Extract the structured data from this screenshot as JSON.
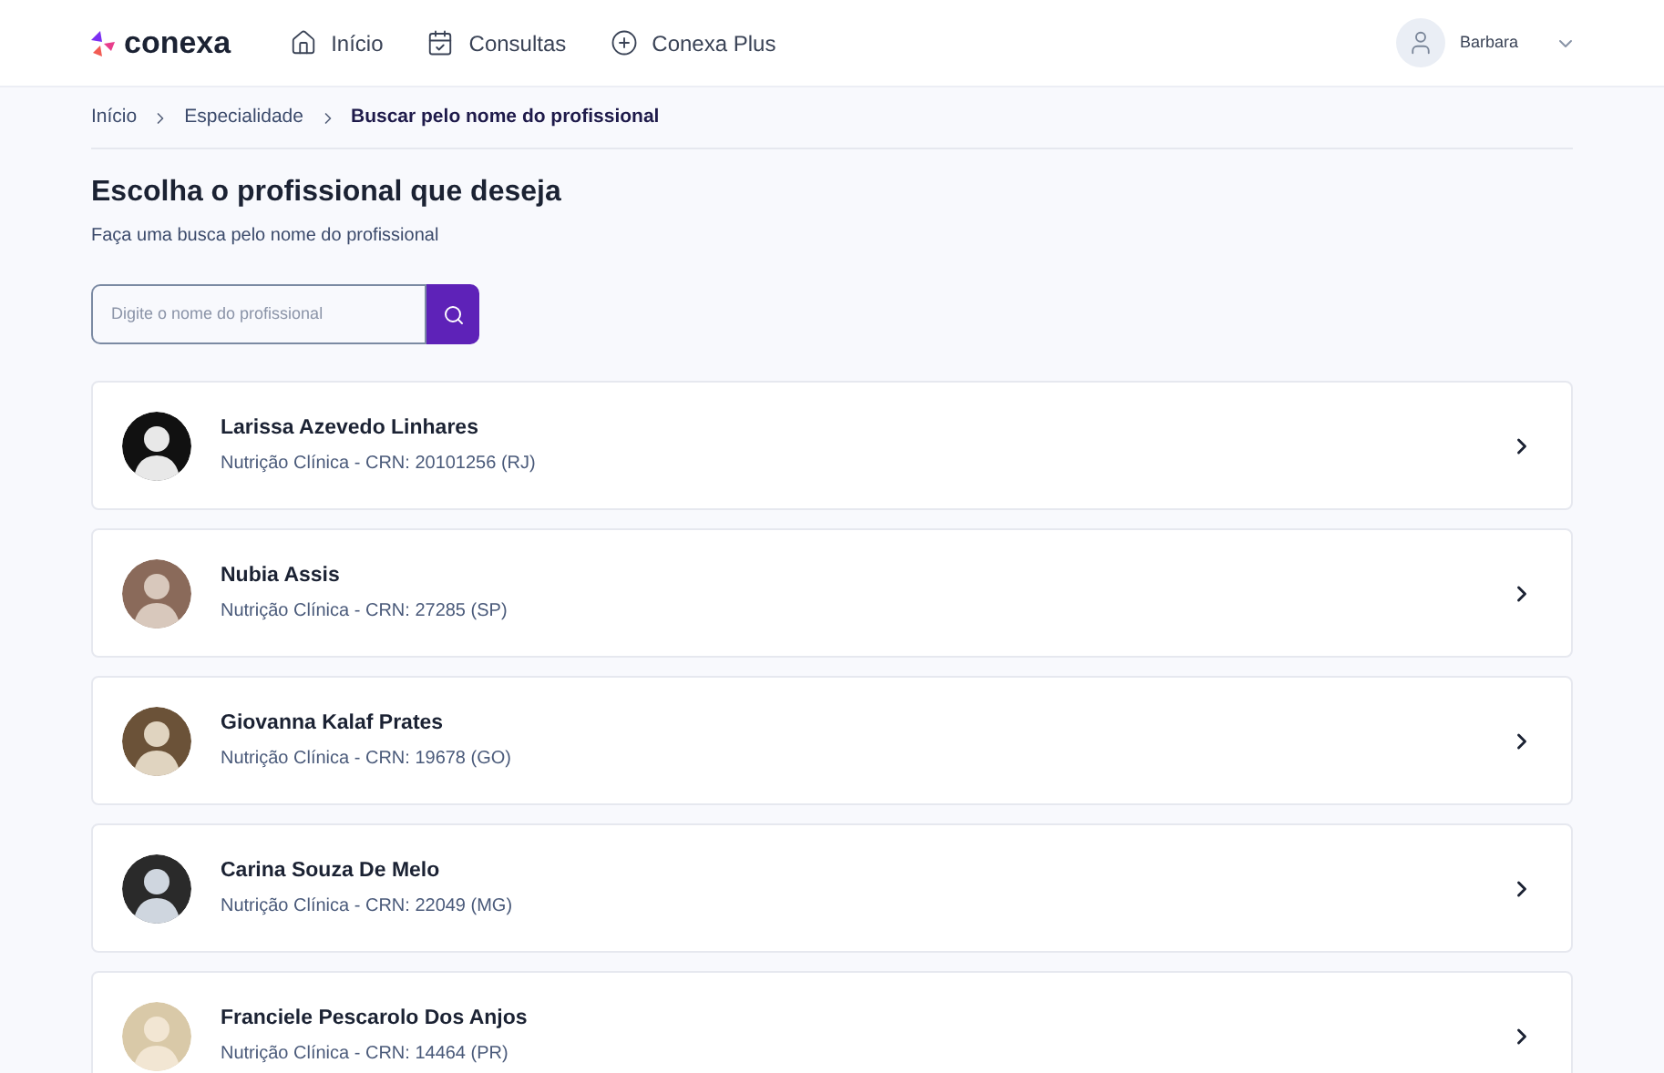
{
  "header": {
    "logo": "conexa",
    "nav": [
      {
        "label": "Início",
        "kind": "home"
      },
      {
        "label": "Consultas",
        "kind": "consults"
      },
      {
        "label": "Conexa Plus",
        "kind": "plus"
      }
    ],
    "user": "Barbara"
  },
  "breadcrumb": [
    "Início",
    "Especialidade",
    "Buscar pelo nome do profissional"
  ],
  "title": "Escolha o profissional que deseja",
  "subtitle": "Faça uma busca pelo nome do profissional",
  "search": {
    "placeholder": "Digite o nome do profissional"
  },
  "professionals": [
    {
      "name": "Larissa Azevedo Linhares",
      "info": "Nutrição Clínica - CRN: 20101256 (RJ)"
    },
    {
      "name": "Nubia Assis",
      "info": "Nutrição Clínica - CRN: 27285 (SP)"
    },
    {
      "name": "Giovanna Kalaf Prates",
      "info": "Nutrição Clínica - CRN: 19678 (GO)"
    },
    {
      "name": "Carina Souza De Melo",
      "info": "Nutrição Clínica - CRN: 22049 (MG)"
    },
    {
      "name": "Franciele Pescarolo Dos Anjos",
      "info": "Nutrição Clínica - CRN: 14464 (PR)"
    }
  ]
}
